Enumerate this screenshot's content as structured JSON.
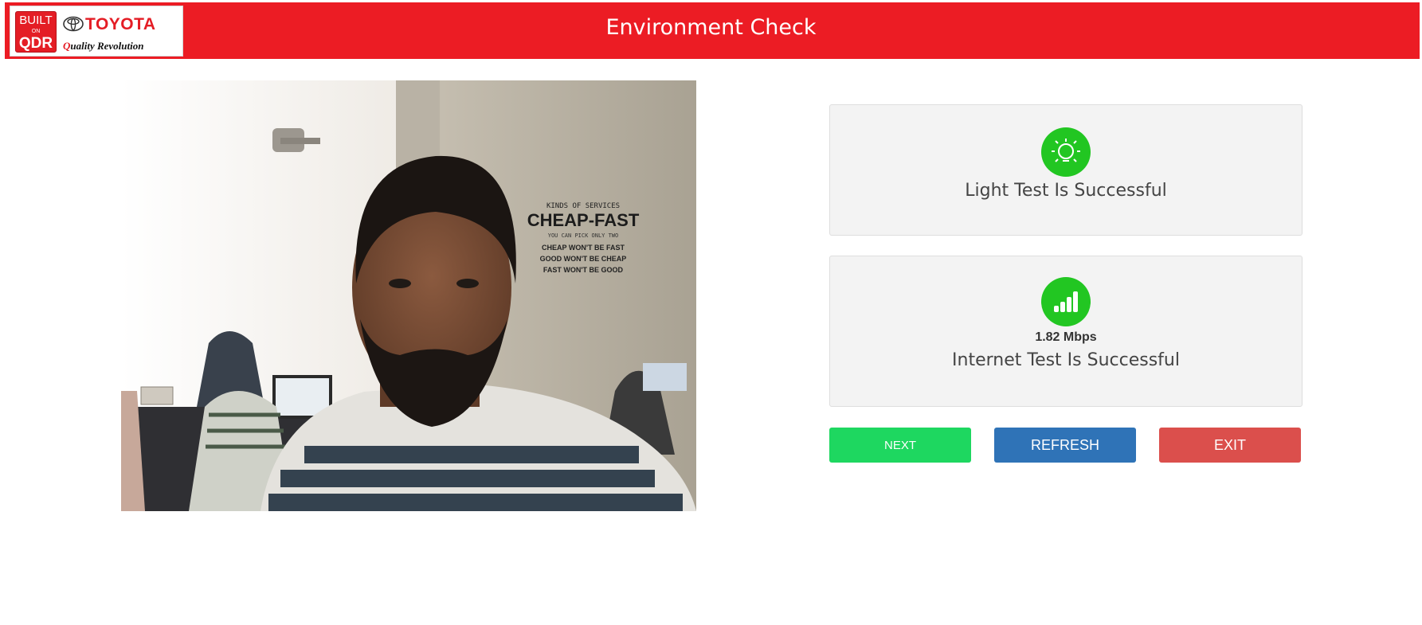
{
  "header": {
    "title": "Environment Check",
    "logo": {
      "badge_top": "BUILT",
      "badge_mid": "ON",
      "badge_bottom": "QDR",
      "brand": "TOYOTA",
      "tagline_q": "Q",
      "tagline_rest": "uality Revolution"
    }
  },
  "camera": {
    "poster_line1": "KINDS OF SERVICES",
    "poster_line2": "CHEAP-FAST",
    "poster_line3": "YOU CAN PICK ONLY TWO",
    "poster_line4": "CHEAP  WON'T BE  FAST",
    "poster_line5": "GOOD  WON'T BE  CHEAP",
    "poster_line6": "FAST  WON'T BE  GOOD"
  },
  "checks": {
    "light": {
      "icon": "light-bulb-icon",
      "text": "Light Test Is Successful"
    },
    "internet": {
      "icon": "signal-bars-icon",
      "speed": "1.82 Mbps",
      "text": "Internet Test Is Successful"
    }
  },
  "buttons": {
    "next": "NEXT",
    "refresh": "REFRESH",
    "exit": "EXIT"
  },
  "colors": {
    "header_bg": "#ec1c24",
    "success": "#22c622",
    "next": "#1ed760",
    "refresh": "#2f73b7",
    "exit": "#db4f4c"
  }
}
